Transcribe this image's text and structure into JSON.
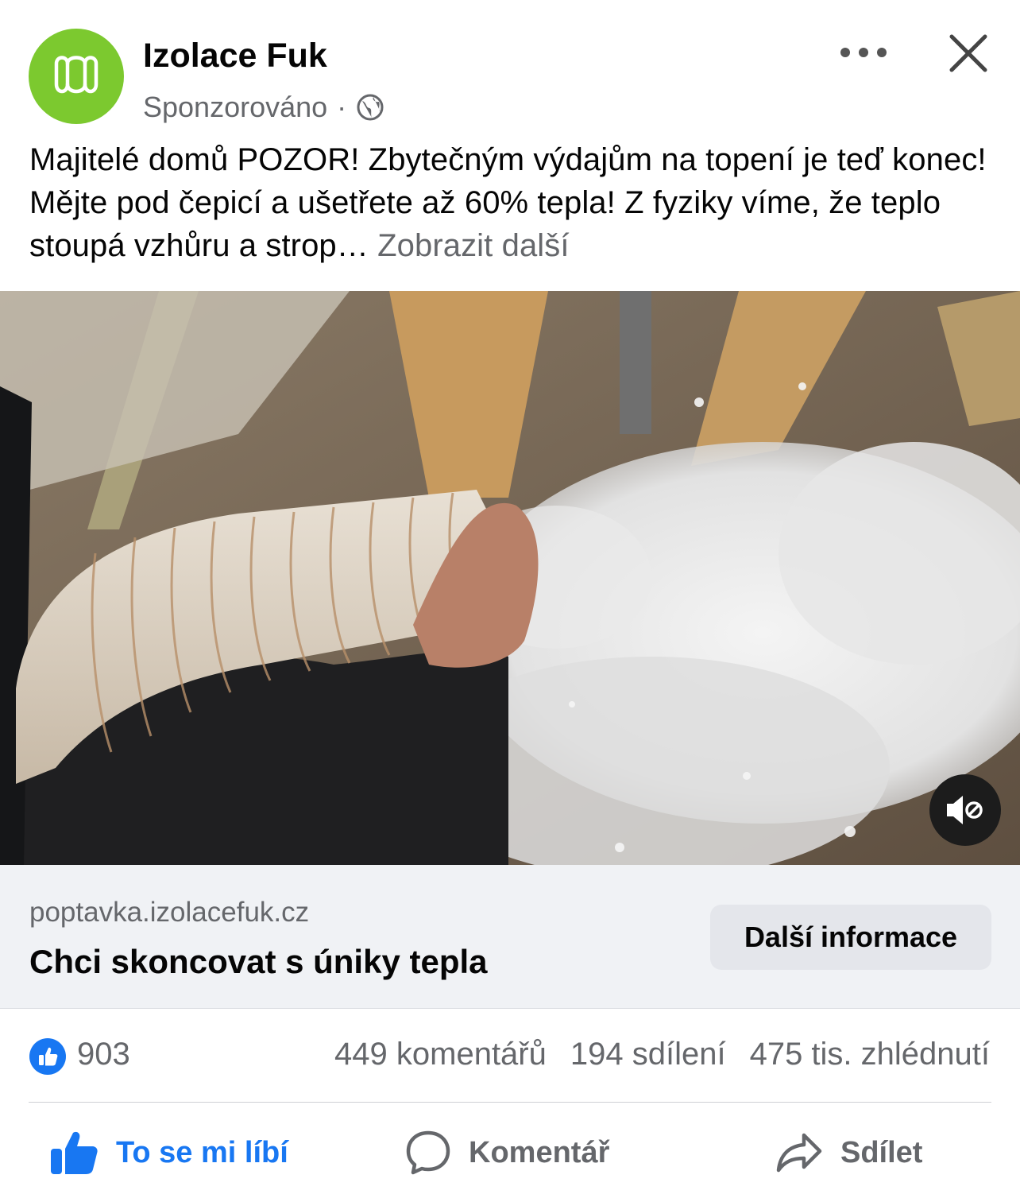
{
  "header": {
    "page_name": "Izolace Fuk",
    "sponsored_label": "Sponzorováno",
    "separator": "·",
    "privacy_icon": "globe-icon",
    "more_icon": "more-dots-icon",
    "close_icon": "close-icon"
  },
  "post": {
    "text": "Majitelé domů POZOR! Zbytečným výdajům na topení je teď konec! Mějte pod čepicí a ušetřete až 60% tepla! Z fyziky víme, že teplo stoupá vzhůru a strop…",
    "see_more": "Zobrazit další"
  },
  "video": {
    "mute_icon": "muted-speaker-icon"
  },
  "link_card": {
    "domain": "poptavka.izolacefuk.cz",
    "title": "Chci skoncovat s úniky tepla",
    "cta": "Další informace"
  },
  "stats": {
    "reactions": "903",
    "comments": "449 komentářů",
    "shares": "194 sdílení",
    "views": "475 tis. zhlédnutí"
  },
  "actions": {
    "like": "To se mi líbí",
    "comment": "Komentář",
    "share": "Sdílet"
  },
  "colors": {
    "brand_green": "#7cc92f",
    "facebook_blue": "#1877f2",
    "secondary_text": "#65676b"
  }
}
